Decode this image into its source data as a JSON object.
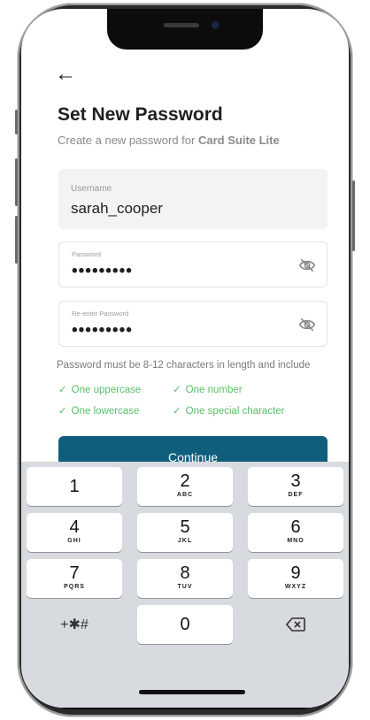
{
  "header": {
    "back_icon": "arrow-left-icon",
    "title": "Set New Password",
    "subtitle_prefix": "Create a new password for",
    "app_name": "Card Suite Lite"
  },
  "form": {
    "username": {
      "label": "Username",
      "value": "sarah_cooper"
    },
    "password": {
      "label": "Password",
      "value": "•••••••••",
      "icon": "eye-off-icon"
    },
    "confirm": {
      "label": "Re-enter Password",
      "value": "•••••••••",
      "icon": "eye-off-icon"
    }
  },
  "requirements": {
    "text": "Password must be 8-12 characters in length and include",
    "checks": [
      "One uppercase",
      "One number",
      "One lowercase",
      "One special character"
    ],
    "check_color": "#5bbf6a"
  },
  "continue_label": "Continue",
  "keypad": {
    "keys": [
      {
        "num": "1",
        "letters": ""
      },
      {
        "num": "2",
        "letters": "ABC"
      },
      {
        "num": "3",
        "letters": "DEF"
      },
      {
        "num": "4",
        "letters": "GHI"
      },
      {
        "num": "5",
        "letters": "JKL"
      },
      {
        "num": "6",
        "letters": "MNO"
      },
      {
        "num": "7",
        "letters": "PQRS"
      },
      {
        "num": "8",
        "letters": "TUV"
      },
      {
        "num": "9",
        "letters": "WXYZ"
      }
    ],
    "symbols_label": "+✱#",
    "zero": "0",
    "delete_icon": "backspace-icon"
  },
  "colors": {
    "accent": "#0f5f7c",
    "keypad_bg": "#d7dade"
  }
}
